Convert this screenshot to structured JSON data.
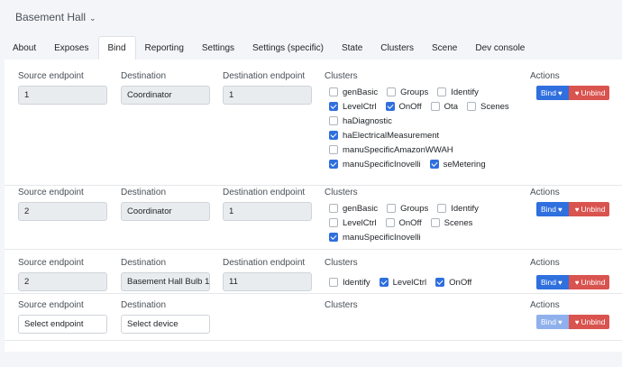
{
  "header": {
    "title": "Basement Hall"
  },
  "tabs": [
    {
      "label": "About",
      "active": false
    },
    {
      "label": "Exposes",
      "active": false
    },
    {
      "label": "Bind",
      "active": true
    },
    {
      "label": "Reporting",
      "active": false
    },
    {
      "label": "Settings",
      "active": false
    },
    {
      "label": "Settings (specific)",
      "active": false
    },
    {
      "label": "State",
      "active": false
    },
    {
      "label": "Clusters",
      "active": false
    },
    {
      "label": "Scene",
      "active": false
    },
    {
      "label": "Dev console",
      "active": false
    }
  ],
  "labels": {
    "source_endpoint": "Source endpoint",
    "destination": "Destination",
    "destination_endpoint": "Destination endpoint",
    "clusters": "Clusters",
    "actions": "Actions",
    "bind": "Bind",
    "unbind": "Unbind"
  },
  "rows": [
    {
      "source_endpoint": "1",
      "destination": "Coordinator",
      "destination_endpoint": "1",
      "cluster_lines": [
        [
          {
            "name": "genBasic",
            "checked": false
          },
          {
            "name": "Groups",
            "checked": false
          },
          {
            "name": "Identify",
            "checked": false
          }
        ],
        [
          {
            "name": "LevelCtrl",
            "checked": true
          },
          {
            "name": "OnOff",
            "checked": true
          },
          {
            "name": "Ota",
            "checked": false
          },
          {
            "name": "Scenes",
            "checked": false
          }
        ],
        [
          {
            "name": "haDiagnostic",
            "checked": false
          }
        ],
        [
          {
            "name": "haElectricalMeasurement",
            "checked": true
          }
        ],
        [
          {
            "name": "manuSpecificAmazonWWAH",
            "checked": false
          }
        ],
        [
          {
            "name": "manuSpecificInovelli",
            "checked": true
          },
          {
            "name": "seMetering",
            "checked": true
          }
        ]
      ]
    },
    {
      "source_endpoint": "2",
      "destination": "Coordinator",
      "destination_endpoint": "1",
      "cluster_lines": [
        [
          {
            "name": "genBasic",
            "checked": false
          },
          {
            "name": "Groups",
            "checked": false
          },
          {
            "name": "Identify",
            "checked": false
          }
        ],
        [
          {
            "name": "LevelCtrl",
            "checked": false
          },
          {
            "name": "OnOff",
            "checked": false
          },
          {
            "name": "Scenes",
            "checked": false
          }
        ],
        [
          {
            "name": "manuSpecificInovelli",
            "checked": true
          }
        ]
      ]
    },
    {
      "source_endpoint": "2",
      "destination": "Basement Hall Bulb 1",
      "destination_endpoint": "11",
      "cluster_lines": [
        [
          {
            "name": "Identify",
            "checked": false
          },
          {
            "name": "LevelCtrl",
            "checked": true
          },
          {
            "name": "OnOff",
            "checked": true
          }
        ]
      ]
    },
    {
      "source_endpoint": "Select endpoint",
      "destination": "Select device",
      "destination_endpoint": "",
      "cluster_lines": []
    }
  ],
  "colors": {
    "primary": "#2f6fde",
    "danger": "#d9534f",
    "bg": "#f4f5f9"
  }
}
